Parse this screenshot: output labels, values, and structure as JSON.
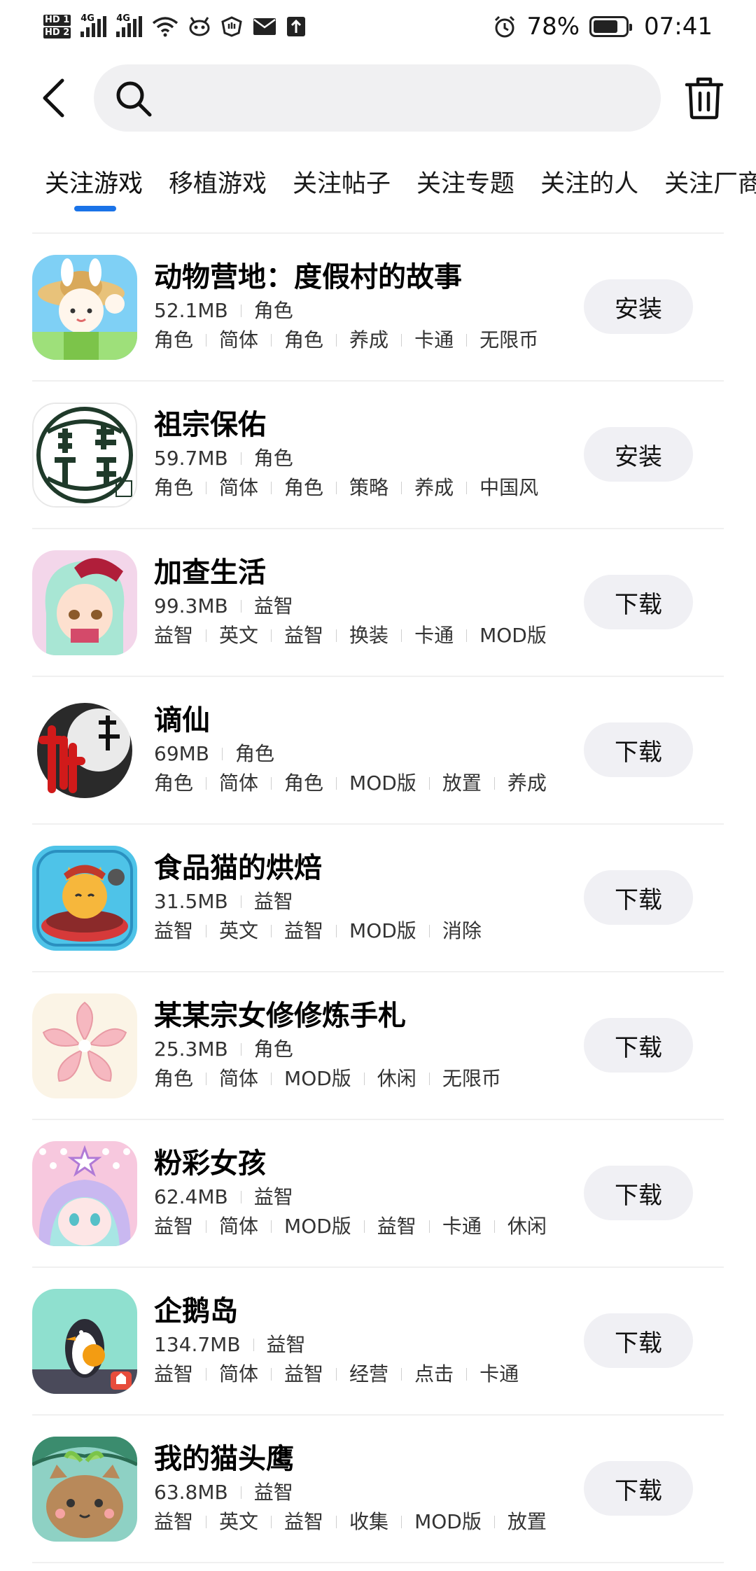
{
  "status_bar": {
    "hd1": "HD 1",
    "hd2": "HD 2",
    "network1": "4G",
    "network2": "4G",
    "battery_percent": "78%",
    "battery_level": 0.78,
    "time": "07:41"
  },
  "header": {
    "search_placeholder": ""
  },
  "tabs": [
    {
      "label": "关注游戏",
      "active": true
    },
    {
      "label": "移植游戏"
    },
    {
      "label": "关注帖子"
    },
    {
      "label": "关注专题"
    },
    {
      "label": "关注的人"
    },
    {
      "label": "关注厂商"
    }
  ],
  "apps": [
    {
      "name": "动物营地：度假村的故事",
      "size": "52.1MB",
      "category": "角色",
      "tags": [
        "角色",
        "简体",
        "角色",
        "养成",
        "卡通",
        "无限币"
      ],
      "action": "安装",
      "icon_name": "animal-camp-icon"
    },
    {
      "name": "祖宗保佑",
      "size": "59.7MB",
      "category": "角色",
      "tags": [
        "角色",
        "简体",
        "角色",
        "策略",
        "养成",
        "中国风"
      ],
      "action": "安装",
      "icon_name": "ancestor-blessing-icon"
    },
    {
      "name": "加查生活",
      "size": "99.3MB",
      "category": "益智",
      "tags": [
        "益智",
        "英文",
        "益智",
        "换装",
        "卡通",
        "MOD版"
      ],
      "action": "下载",
      "icon_name": "gacha-life-icon"
    },
    {
      "name": "谪仙",
      "size": "69MB",
      "category": "角色",
      "tags": [
        "角色",
        "简体",
        "角色",
        "MOD版",
        "放置",
        "养成"
      ],
      "action": "下载",
      "icon_name": "zhexian-icon"
    },
    {
      "name": "食品猫的烘焙",
      "size": "31.5MB",
      "category": "益智",
      "tags": [
        "益智",
        "英文",
        "益智",
        "MOD版",
        "消除"
      ],
      "action": "下载",
      "icon_name": "food-cat-icon"
    },
    {
      "name": "某某宗女修修炼手札",
      "size": "25.3MB",
      "category": "角色",
      "tags": [
        "角色",
        "简体",
        "MOD版",
        "休闲",
        "无限币"
      ],
      "action": "下载",
      "icon_name": "peach-blossom-icon"
    },
    {
      "name": "粉彩女孩",
      "size": "62.4MB",
      "category": "益智",
      "tags": [
        "益智",
        "简体",
        "MOD版",
        "益智",
        "卡通",
        "休闲"
      ],
      "action": "下载",
      "icon_name": "pastel-girl-icon"
    },
    {
      "name": "企鹅岛",
      "size": "134.7MB",
      "category": "益智",
      "tags": [
        "益智",
        "简体",
        "益智",
        "经营",
        "点击",
        "卡通"
      ],
      "action": "下载",
      "icon_name": "penguin-isle-icon"
    },
    {
      "name": "我的猫头鹰",
      "size": "63.8MB",
      "category": "益智",
      "tags": [
        "益智",
        "英文",
        "益智",
        "收集",
        "MOD版",
        "放置"
      ],
      "action": "下载",
      "icon_name": "my-owl-icon"
    }
  ],
  "colors": {
    "accent": "#1a73e8",
    "button_bg": "#f0f0f4",
    "search_bg": "#f0f0f2"
  }
}
